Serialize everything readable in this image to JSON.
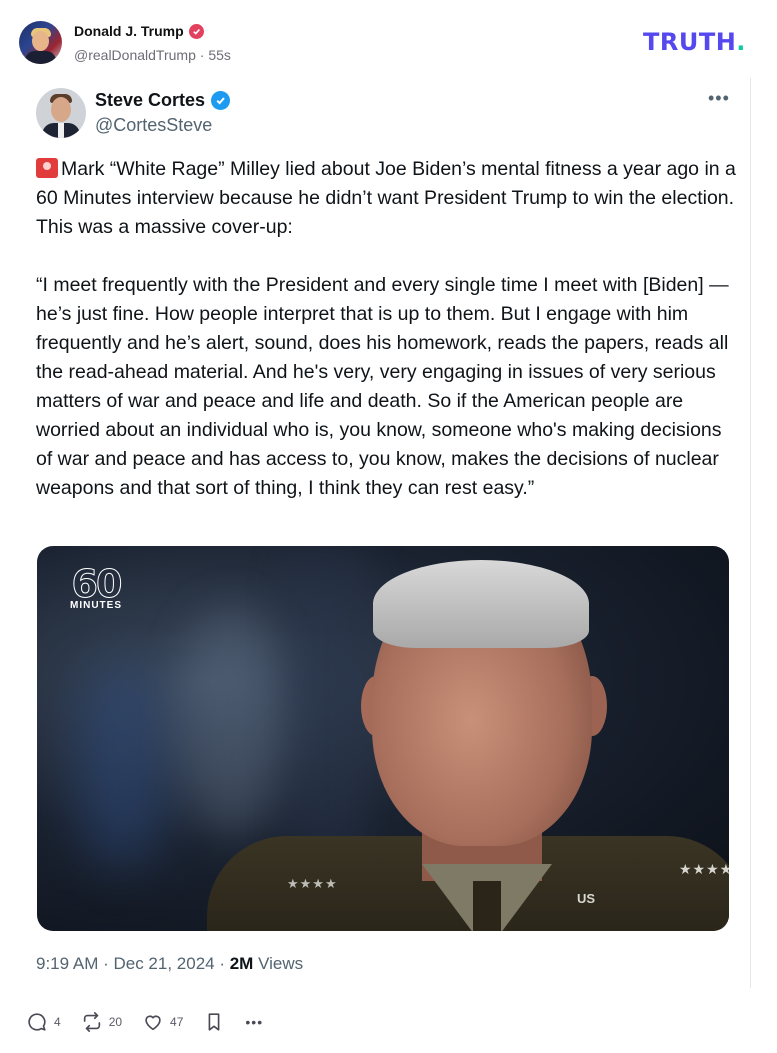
{
  "truth_post": {
    "author_name": "Donald J. Trump",
    "author_handle": "@realDonaldTrump",
    "separator": "·",
    "time_ago": "55s",
    "brand_logo": "TRUTH",
    "brand_dot": "."
  },
  "embedded_post": {
    "author_name": "Steve Cortes",
    "author_handle": "@CortesSteve",
    "more_label": "•••",
    "text": "Mark “White Rage” Milley lied about Joe Biden’s mental fitness a year ago in a 60 Minutes interview because he didn’t want President Trump to win the election. This was a massive cover-up:\n\n“I meet frequently with the President and every single time I meet with [Biden] — he’s just fine. How people interpret that is up to them. But I engage with him frequently and he’s alert, sound, does his homework, reads the papers, reads all the read-ahead material. And he's very, very engaging in issues of very serious matters of war and peace and life and death. So if the American people are worried about an individual who is, you know, someone who's making decisions of war and peace and has access to, you know, makes the decisions of nuclear weapons and that sort of thing, I think they can rest easy.”",
    "media": {
      "logo_number": "60",
      "logo_word": "MINUTES",
      "collar_insignia": "US",
      "shoulder_stars": "★★★★"
    },
    "timestamp": "9:19 AM · Dec 21, 2024 · ",
    "views_count": "2M",
    "views_label": " Views"
  },
  "actions": {
    "replies": "4",
    "retruths": "20",
    "likes": "47",
    "more": "•••"
  },
  "colors": {
    "truth_brand": "#5448ee",
    "truth_dot": "#13c9a5",
    "truth_verified": "#e2425e",
    "x_verified": "#1d9bf0"
  }
}
